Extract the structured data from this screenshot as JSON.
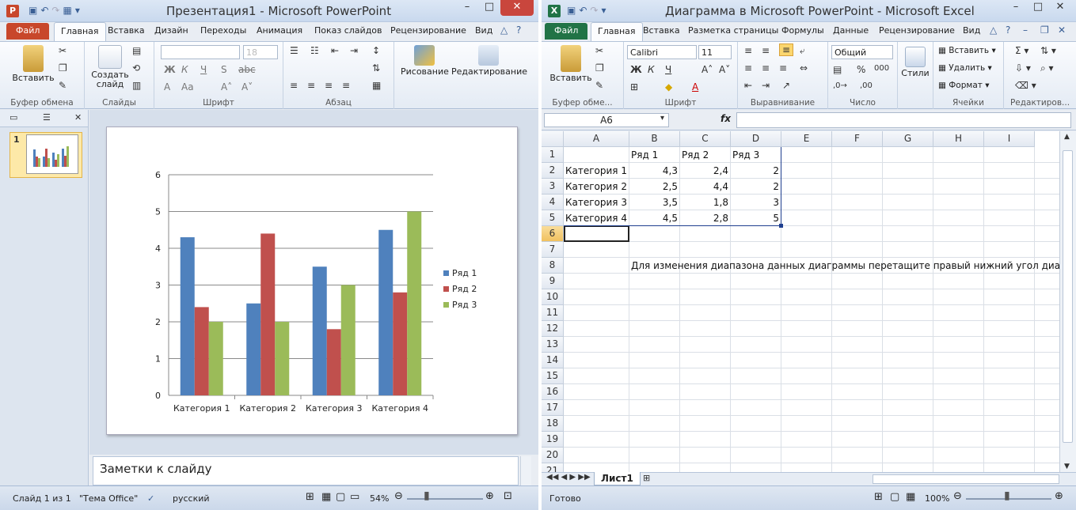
{
  "powerpoint": {
    "title": "Презентация1 - Microsoft PowerPoint",
    "tabs": [
      "Файл",
      "Главная",
      "Вставка",
      "Дизайн",
      "Переходы",
      "Анимация",
      "Показ слайдов",
      "Рецензирование",
      "Вид"
    ],
    "ribbon": {
      "paste": "Вставить",
      "new_slide": "Создать слайд",
      "font_size": "18",
      "drawing": "Рисование",
      "editing": "Редактирование",
      "groups": [
        "Буфер обмена",
        "Слайды",
        "Шрифт",
        "Абзац"
      ]
    },
    "slide_number": "1",
    "notes": "Заметки к слайду",
    "status": {
      "slide": "Слайд 1 из 1",
      "theme": "\"Тема Office\"",
      "lang": "русский",
      "zoom": "54%"
    },
    "colors": {
      "file_tab": "#c8472b",
      "accent": "#2b579a"
    }
  },
  "chart_data": {
    "type": "bar",
    "categories": [
      "Категория 1",
      "Категория 2",
      "Категория 3",
      "Категория 4"
    ],
    "series": [
      {
        "name": "Ряд 1",
        "values": [
          4.3,
          2.5,
          3.5,
          4.5
        ],
        "color": "#4f81bd"
      },
      {
        "name": "Ряд 2",
        "values": [
          2.4,
          4.4,
          1.8,
          2.8
        ],
        "color": "#c0504d"
      },
      {
        "name": "Ряд 3",
        "values": [
          2,
          2,
          3,
          5
        ],
        "color": "#9bbb59"
      }
    ],
    "yticks": [
      "0",
      "1",
      "2",
      "3",
      "4",
      "5",
      "6"
    ],
    "ylim": [
      0,
      6
    ],
    "grid": true,
    "legend": "right"
  },
  "excel": {
    "title": "Диаграмма в Microsoft PowerPoint - Microsoft Excel",
    "tabs": [
      "Файл",
      "Главная",
      "Вставка",
      "Разметка страницы",
      "Формулы",
      "Данные",
      "Рецензирование",
      "Вид"
    ],
    "ribbon": {
      "paste": "Вставить",
      "font_name": "Calibri",
      "font_size": "11",
      "number_format": "Общий",
      "styles": "Стили",
      "insert": "Вставить",
      "delete": "Удалить",
      "format": "Формат",
      "groups": [
        "Буфер обме...",
        "Шрифт",
        "Выравнивание",
        "Число",
        "Ячейки",
        "Редактиров..."
      ]
    },
    "name_box": "A6",
    "fx": "fx",
    "columns": [
      "A",
      "B",
      "C",
      "D",
      "E",
      "F",
      "G",
      "H",
      "I"
    ],
    "rows": [
      "1",
      "2",
      "3",
      "4",
      "5",
      "6",
      "7",
      "8",
      "9",
      "10",
      "11",
      "12",
      "13",
      "14",
      "15",
      "16",
      "17",
      "18",
      "19",
      "20",
      "21"
    ],
    "header_row": [
      "",
      "Ряд 1",
      "Ряд 2",
      "Ряд 3"
    ],
    "data_rows": [
      [
        "Категория 1",
        "4,3",
        "2,4",
        "2"
      ],
      [
        "Категория 2",
        "2,5",
        "4,4",
        "2"
      ],
      [
        "Категория 3",
        "3,5",
        "1,8",
        "3"
      ],
      [
        "Категория 4",
        "4,5",
        "2,8",
        "5"
      ]
    ],
    "note": "Для изменения диапазона данных диаграммы перетащите правый нижний угол диапа",
    "sheet": "Лист1",
    "status": {
      "ready": "Готово",
      "zoom": "100%"
    },
    "colors": {
      "file_tab": "#217346"
    }
  }
}
